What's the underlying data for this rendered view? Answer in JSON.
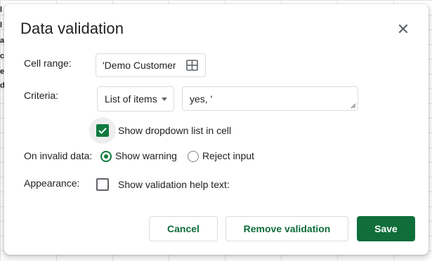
{
  "dialog": {
    "title": "Data validation",
    "close_icon": "close-icon"
  },
  "cell_range": {
    "label": "Cell range:",
    "value": "'Demo Customer",
    "icon": "grid-select-icon"
  },
  "criteria": {
    "label": "Criteria:",
    "selected": "List of items",
    "items_value": "yes, '"
  },
  "dropdown_option": {
    "checked": true,
    "label": "Show dropdown list in cell"
  },
  "invalid_data": {
    "label": "On invalid data:",
    "options": [
      {
        "label": "Show warning",
        "selected": true
      },
      {
        "label": "Reject input",
        "selected": false
      }
    ]
  },
  "appearance": {
    "label": "Appearance:",
    "checked": false,
    "help_text_label": "Show validation help text:"
  },
  "buttons": {
    "cancel": "Cancel",
    "remove": "Remove validation",
    "save": "Save"
  },
  "colors": {
    "accent": "#0f6e3a",
    "border": "#dadce0",
    "text": "#202124"
  },
  "background_fragments": [
    "l",
    "l",
    "a",
    "c",
    "e",
    "d"
  ]
}
